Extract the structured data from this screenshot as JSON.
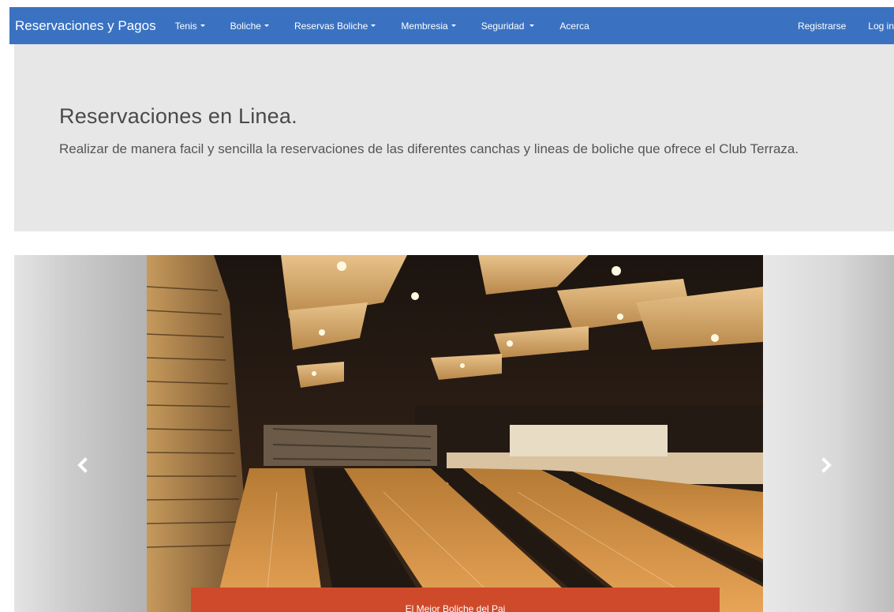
{
  "navbar": {
    "brand": "Reservaciones y Pagos",
    "items": [
      {
        "label": "Tenis"
      },
      {
        "label": "Boliche"
      },
      {
        "label": "Reservas Boliche"
      },
      {
        "label": "Membresia"
      },
      {
        "label": "Seguridad"
      },
      {
        "label": "Acerca"
      }
    ],
    "right": [
      {
        "label": "Registrarse"
      },
      {
        "label": "Log in"
      }
    ],
    "color": "#3a72c1"
  },
  "jumbotron": {
    "title": "Reservaciones en Linea.",
    "text": "Realizar de manera facil y sencilla la reservaciones de las diferentes canchas y lineas de boliche que ofrece el Club Terraza."
  },
  "carousel": {
    "caption": "El Mejor Boliche del Pai",
    "caption_color": "#cf4a2b"
  }
}
